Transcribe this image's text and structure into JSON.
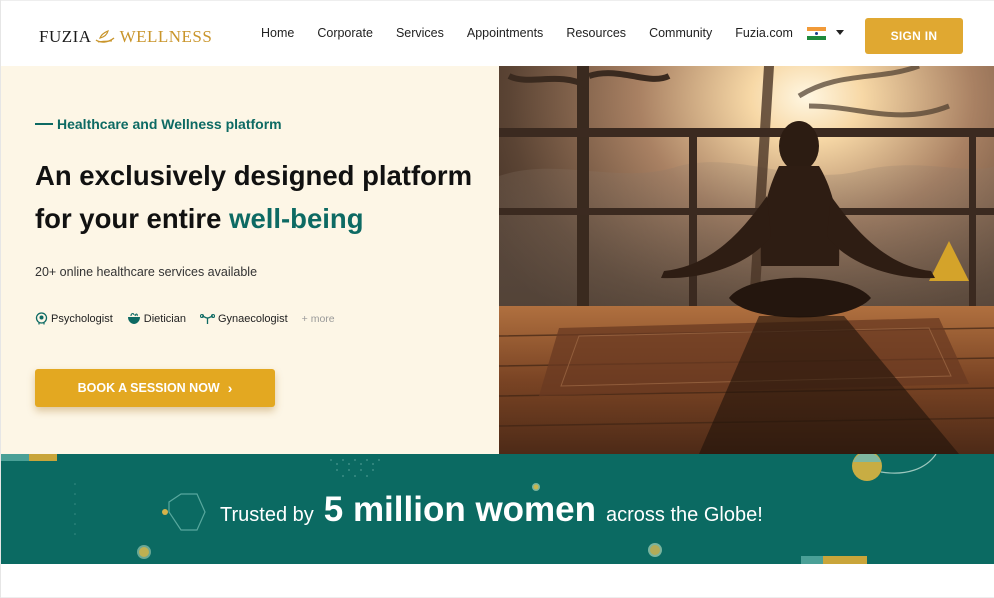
{
  "header": {
    "logo_part1": "FUZIA",
    "logo_part2": "WELLNESS",
    "nav": [
      "Home",
      "Corporate",
      "Services",
      "Appointments",
      "Resources",
      "Community",
      "Fuzia.com"
    ],
    "signin_label": "SIGN IN",
    "colors": {
      "gold": "#e0a831",
      "teal": "#0d6a63"
    }
  },
  "hero": {
    "eyebrow": "Healthcare and Wellness platform",
    "headline_line1": "An exclusively designed platform",
    "headline_line2_plain": "for your entire ",
    "headline_line2_accent": "well-being",
    "subtitle": "20+ online healthcare services available",
    "tags": [
      "Psychologist",
      "Dietician",
      "Gynaecologist"
    ],
    "more_label": "+ more",
    "cta_label": "BOOK A SESSION NOW",
    "cta_icon": "chevron-right-icon",
    "image_alt": "woman meditating on a wooden deck at sunset"
  },
  "band": {
    "prefix": "Trusted by",
    "highlight": "5 million women",
    "suffix": "across the Globe!",
    "background": "#0b6a62"
  }
}
